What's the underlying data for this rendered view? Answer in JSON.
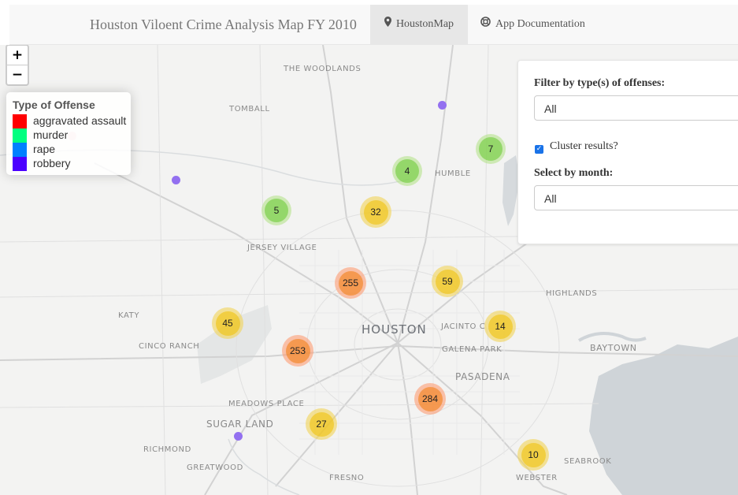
{
  "app": {
    "title": "Houston Viloent Crime Analysis Map FY 2010",
    "tabs": [
      {
        "label": "HoustonMap",
        "icon": "map-marker-icon",
        "active": true
      },
      {
        "label": "App Documentation",
        "icon": "life-ring-icon",
        "active": false
      }
    ]
  },
  "map": {
    "zoom_in_label": "+",
    "zoom_out_label": "−",
    "places": {
      "woodlands": "THE WOODLANDS",
      "tomball": "TOMBALL",
      "humble": "HUMBLE",
      "jersey_village": "JERSEY VILLAGE",
      "highlands": "HIGHLANDS",
      "katy": "KATY",
      "houston": "HOUSTON",
      "jacinto": "JACINTO C",
      "cinco_ranch": "CINCO RANCH",
      "galena_park": "GALENA PARK",
      "baytown": "BAYTOWN",
      "pasadena": "PASADENA",
      "meadows_place": "MEADOWS PLACE",
      "sugar_land": "SUGAR LAND",
      "richmond": "RICHMOND",
      "seabrook": "SEABROOK",
      "greatwood": "GREATWOOD",
      "fresno": "FRESNO",
      "webster": "WEBSTER"
    },
    "clusters": [
      {
        "count": "7",
        "size": "small"
      },
      {
        "count": "4",
        "size": "small"
      },
      {
        "count": "5",
        "size": "small"
      },
      {
        "count": "32",
        "size": "medium"
      },
      {
        "count": "255",
        "size": "large"
      },
      {
        "count": "59",
        "size": "medium"
      },
      {
        "count": "45",
        "size": "medium"
      },
      {
        "count": "14",
        "size": "medium"
      },
      {
        "count": "253",
        "size": "large"
      },
      {
        "count": "284",
        "size": "large"
      },
      {
        "count": "27",
        "size": "medium"
      },
      {
        "count": "10",
        "size": "medium"
      }
    ]
  },
  "legend": {
    "title": "Type of Offense",
    "items": [
      {
        "label": "aggravated assault",
        "color": "#ff0000"
      },
      {
        "label": "murder",
        "color": "#00ff80"
      },
      {
        "label": "rape",
        "color": "#0080ff"
      },
      {
        "label": "robbery",
        "color": "#4b00ff"
      }
    ]
  },
  "controls": {
    "offense_label": "Filter by type(s) of offenses:",
    "offense_value": "All",
    "cluster_label": "Cluster results?",
    "cluster_checked": true,
    "month_label": "Select by month:",
    "month_value": "All"
  },
  "colors": {
    "water": "#cfd4d8",
    "robbery_dot": "#9370f0",
    "checkbox_accent": "#1a73e8"
  }
}
